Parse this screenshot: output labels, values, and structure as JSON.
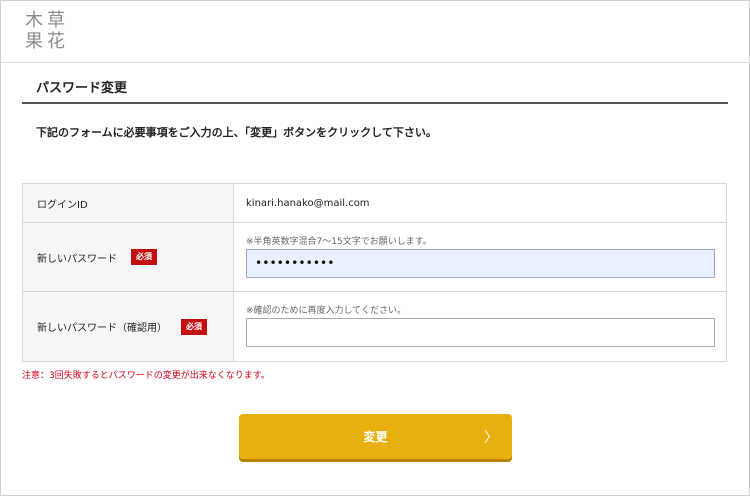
{
  "header": {
    "logo_chars": [
      "木",
      "草",
      "果",
      "花"
    ]
  },
  "page": {
    "title": "パスワード変更",
    "instruction": "下記のフォームに必要事項をご入力の上、「変更」ボタンをクリックして下さい。"
  },
  "form": {
    "login_id_label": "ログインID",
    "login_id_value": "kinari.hanako@mail.com",
    "new_password_label": "新しいパスワード",
    "new_password_hint": "※半角英数字混合7～15文字でお願いします。",
    "new_password_value": "•••••••••••",
    "confirm_password_label": "新しいパスワード（確認用）",
    "confirm_password_hint": "※確認のために再度入力してください。",
    "confirm_password_value": "",
    "required_badge": "必須"
  },
  "notice": "注意：3回失敗するとパスワードの変更が出来なくなります。",
  "submit": {
    "label": "変更",
    "chevron_icon": "chevron-right-icon"
  },
  "colors": {
    "accent_button": "#e8b00f",
    "required_badge": "#c40e0e",
    "notice_text": "#d0021b"
  }
}
